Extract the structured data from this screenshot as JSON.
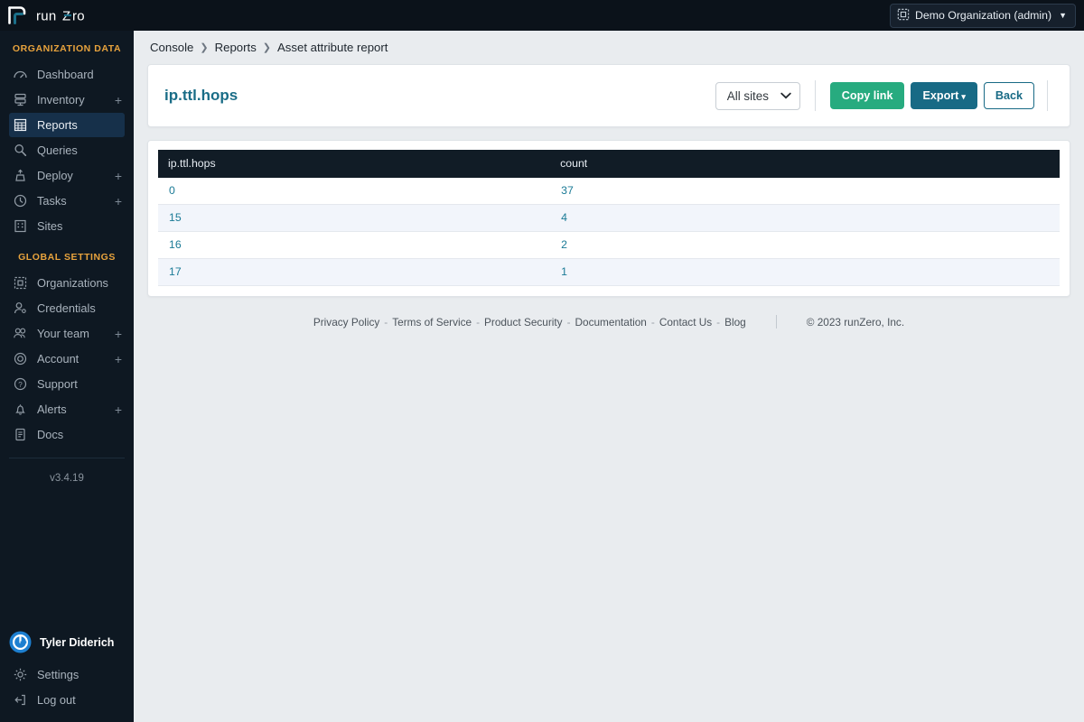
{
  "brand": {
    "name": "runZero",
    "menu_icon": "hamburger-collapse-icon"
  },
  "topbar": {
    "org_label": "Demo Organization (admin)",
    "org_icon": "organization-icon",
    "caret": "▼"
  },
  "sidebar": {
    "sections": [
      {
        "label": "ORGANIZATION DATA",
        "items": [
          {
            "label": "Dashboard",
            "icon": "dashboard-icon",
            "expandable": false,
            "active": false
          },
          {
            "label": "Inventory",
            "icon": "inventory-icon",
            "expandable": true,
            "active": false
          },
          {
            "label": "Reports",
            "icon": "reports-grid-icon",
            "expandable": false,
            "active": true
          },
          {
            "label": "Queries",
            "icon": "magnifier-icon",
            "expandable": false,
            "active": false
          },
          {
            "label": "Deploy",
            "icon": "deploy-icon",
            "expandable": true,
            "active": false
          },
          {
            "label": "Tasks",
            "icon": "tasks-clock-icon",
            "expandable": true,
            "active": false
          },
          {
            "label": "Sites",
            "icon": "sites-building-icon",
            "expandable": false,
            "active": false
          }
        ]
      },
      {
        "label": "GLOBAL SETTINGS",
        "items": [
          {
            "label": "Organizations",
            "icon": "organizations-icon",
            "expandable": false,
            "active": false
          },
          {
            "label": "Credentials",
            "icon": "credentials-user-key-icon",
            "expandable": false,
            "active": false
          },
          {
            "label": "Your team",
            "icon": "team-users-icon",
            "expandable": true,
            "active": false
          },
          {
            "label": "Account",
            "icon": "account-circle-icon",
            "expandable": true,
            "active": false
          },
          {
            "label": "Support",
            "icon": "support-question-icon",
            "expandable": false,
            "active": false
          },
          {
            "label": "Alerts",
            "icon": "bell-icon",
            "expandable": true,
            "active": false
          },
          {
            "label": "Docs",
            "icon": "docs-book-icon",
            "expandable": false,
            "active": false
          }
        ]
      }
    ],
    "expand_symbol": "+",
    "version": "v3.4.19",
    "user": {
      "name": "Tyler Diderich",
      "avatar_icon": "user-avatar-icon"
    },
    "footer_items": [
      {
        "label": "Settings",
        "icon": "gear-icon"
      },
      {
        "label": "Log out",
        "icon": "logout-icon"
      }
    ]
  },
  "breadcrumb": {
    "separator": "❯",
    "items": [
      {
        "label": "Console"
      },
      {
        "label": "Reports"
      },
      {
        "label": "Asset attribute report"
      }
    ]
  },
  "report": {
    "title": "ip.ttl.hops",
    "site_filter": {
      "selected": "All sites",
      "options": [
        "All sites"
      ]
    },
    "buttons": {
      "copy_link": "Copy link",
      "export": "Export",
      "export_caret": "▾",
      "back": "Back"
    }
  },
  "table": {
    "columns": [
      "ip.ttl.hops",
      "count"
    ],
    "rows": [
      {
        "attribute": "0",
        "count": "37"
      },
      {
        "attribute": "15",
        "count": "4"
      },
      {
        "attribute": "16",
        "count": "2"
      },
      {
        "attribute": "17",
        "count": "1"
      }
    ]
  },
  "footer": {
    "links": [
      "Privacy Policy",
      "Terms of Service",
      "Product Security",
      "Documentation",
      "Contact Us",
      "Blog"
    ],
    "separator": "-",
    "copyright": "© 2023 runZero, Inc."
  },
  "colors": {
    "sidebar_bg": "#0e1822",
    "topbar_bg": "#0b121a",
    "accent_orange": "#e8a33d",
    "active_nav_bg": "#16304a",
    "title_teal": "#1a6d87",
    "copy_green": "#27ab7f",
    "export_blue": "#186a85",
    "table_head_bg": "#111c26",
    "link_teal": "#1a7a96",
    "page_bg": "#e9ecef"
  }
}
